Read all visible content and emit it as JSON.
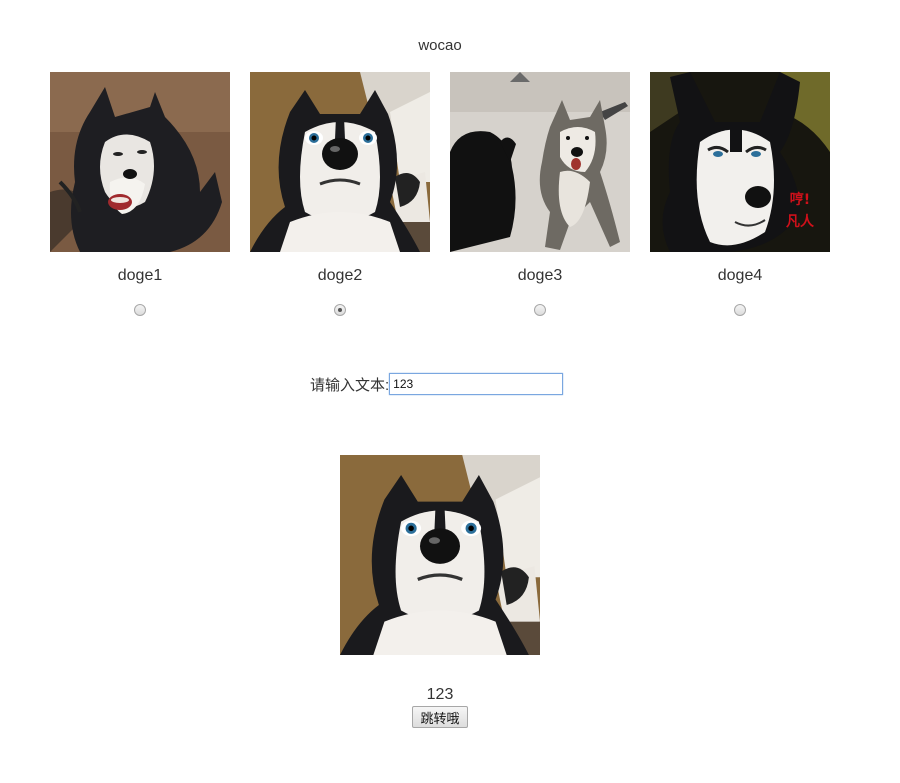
{
  "page": {
    "title": "wocao"
  },
  "gallery": {
    "items": [
      {
        "label": "doge1",
        "selected": false,
        "image": "husky-side-grin"
      },
      {
        "label": "doge2",
        "selected": true,
        "image": "husky-surprised-closeup"
      },
      {
        "label": "doge3",
        "selected": false,
        "image": "husky-jumping"
      },
      {
        "label": "doge4",
        "selected": false,
        "image": "husky-smug",
        "caption": "哼!凡人"
      }
    ]
  },
  "input": {
    "label": "请输入文本:",
    "value": "123"
  },
  "preview": {
    "image": "husky-surprised-closeup",
    "text": "123"
  },
  "button": {
    "label": "跳转哦"
  },
  "colors": {
    "text": "#333333",
    "input_border": "#7aa7e0",
    "caption_red": "#d0101a"
  }
}
